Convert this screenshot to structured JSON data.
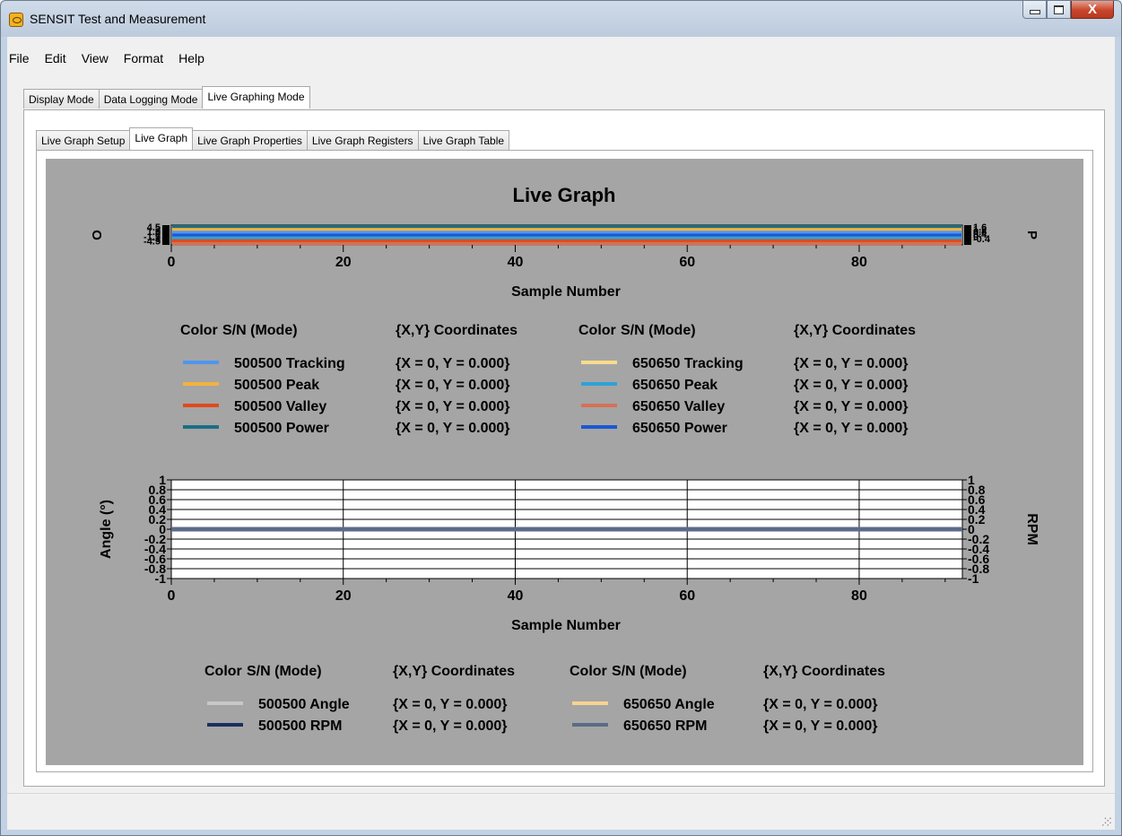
{
  "window": {
    "title": "SENSIT Test and Measurement",
    "close_glyph": "X"
  },
  "menu": [
    "File",
    "Edit",
    "View",
    "Format",
    "Help"
  ],
  "mode_tabs": [
    {
      "label": "Display Mode",
      "active": false
    },
    {
      "label": "Data Logging Mode",
      "active": false
    },
    {
      "label": "Live Graphing Mode",
      "active": true
    }
  ],
  "graph_tabs": [
    {
      "label": "Live Graph Setup",
      "active": false
    },
    {
      "label": "Live Graph",
      "active": true
    },
    {
      "label": "Live Graph Properties",
      "active": false
    },
    {
      "label": "Live Graph Registers",
      "active": false
    },
    {
      "label": "Live Graph Table",
      "active": false
    }
  ],
  "icons": {
    "app": "sensit-app-icon",
    "minimize": "minimize-icon",
    "maximize": "maximize-icon",
    "close": "close-icon",
    "grip": "resize-grip-icon"
  },
  "colors": {
    "plot_background": "#a5a5a5"
  },
  "chart_data": [
    {
      "type": "line",
      "title": "Live Graph",
      "xlabel": "Sample Number",
      "ylabel_left": "O",
      "ylabel_right": "P",
      "xlim": [
        0,
        92
      ],
      "x_ticks": [
        "0",
        "20",
        "40",
        "60",
        "80"
      ],
      "left_ticks_stacked": [
        "4.5",
        "3",
        "1.5",
        "0",
        "-1.5",
        "-3",
        "-4.5"
      ],
      "right_ticks_stacked": [
        "1.6",
        "1.2",
        "0.8",
        "0.4",
        "0",
        "-0.4"
      ],
      "legend_header": {
        "color": "Color",
        "sn": "S/N (Mode)",
        "coords": "{X,Y} Coordinates"
      },
      "series": [
        {
          "name": "500500 Tracking",
          "color": "#4f96f0",
          "coords": "{X = 0, Y = 0.000}"
        },
        {
          "name": "500500 Peak",
          "color": "#f2b23e",
          "coords": "{X = 0, Y = 0.000}"
        },
        {
          "name": "500500 Valley",
          "color": "#e04a1c",
          "coords": "{X = 0, Y = 0.000}"
        },
        {
          "name": "500500 Power",
          "color": "#1c6e84",
          "coords": "{X = 0, Y = 0.000}"
        },
        {
          "name": "650650 Tracking",
          "color": "#f7dc8c",
          "coords": "{X = 0, Y = 0.000}"
        },
        {
          "name": "650650 Peak",
          "color": "#2ea2d8",
          "coords": "{X = 0, Y = 0.000}"
        },
        {
          "name": "650650 Valley",
          "color": "#d47158",
          "coords": "{X = 0, Y = 0.000}"
        },
        {
          "name": "650650 Power",
          "color": "#1c58d6",
          "coords": "{X = 0, Y = 0.000}"
        }
      ]
    },
    {
      "type": "line",
      "title": "",
      "xlabel": "Sample Number",
      "ylabel_left": "Angle (°)",
      "ylabel_right": "RPM",
      "xlim": [
        0,
        92
      ],
      "ylim": [
        -1,
        1
      ],
      "x_ticks": [
        "0",
        "20",
        "40",
        "60",
        "80"
      ],
      "y_ticks": [
        "1",
        "0.8",
        "0.6",
        "0.4",
        "0.2",
        "0",
        "-0.2",
        "-0.4",
        "-0.6",
        "-0.8",
        "-1"
      ],
      "grid": true,
      "legend_header": {
        "color": "Color",
        "sn": "S/N (Mode)",
        "coords": "{X,Y} Coordinates"
      },
      "series": [
        {
          "name": "500500 Angle",
          "color": "#c8c8c8",
          "coords": "{X = 0, Y = 0.000}",
          "y": 0
        },
        {
          "name": "500500 RPM",
          "color": "#1c2f5e",
          "coords": "{X = 0, Y = 0.000}",
          "y": 0
        },
        {
          "name": "650650 Angle",
          "color": "#f6d492",
          "coords": "{X = 0, Y = 0.000}",
          "y": 0
        },
        {
          "name": "650650 RPM",
          "color": "#5a6c88",
          "coords": "{X = 0, Y = 0.000}",
          "y": 0
        }
      ]
    }
  ]
}
